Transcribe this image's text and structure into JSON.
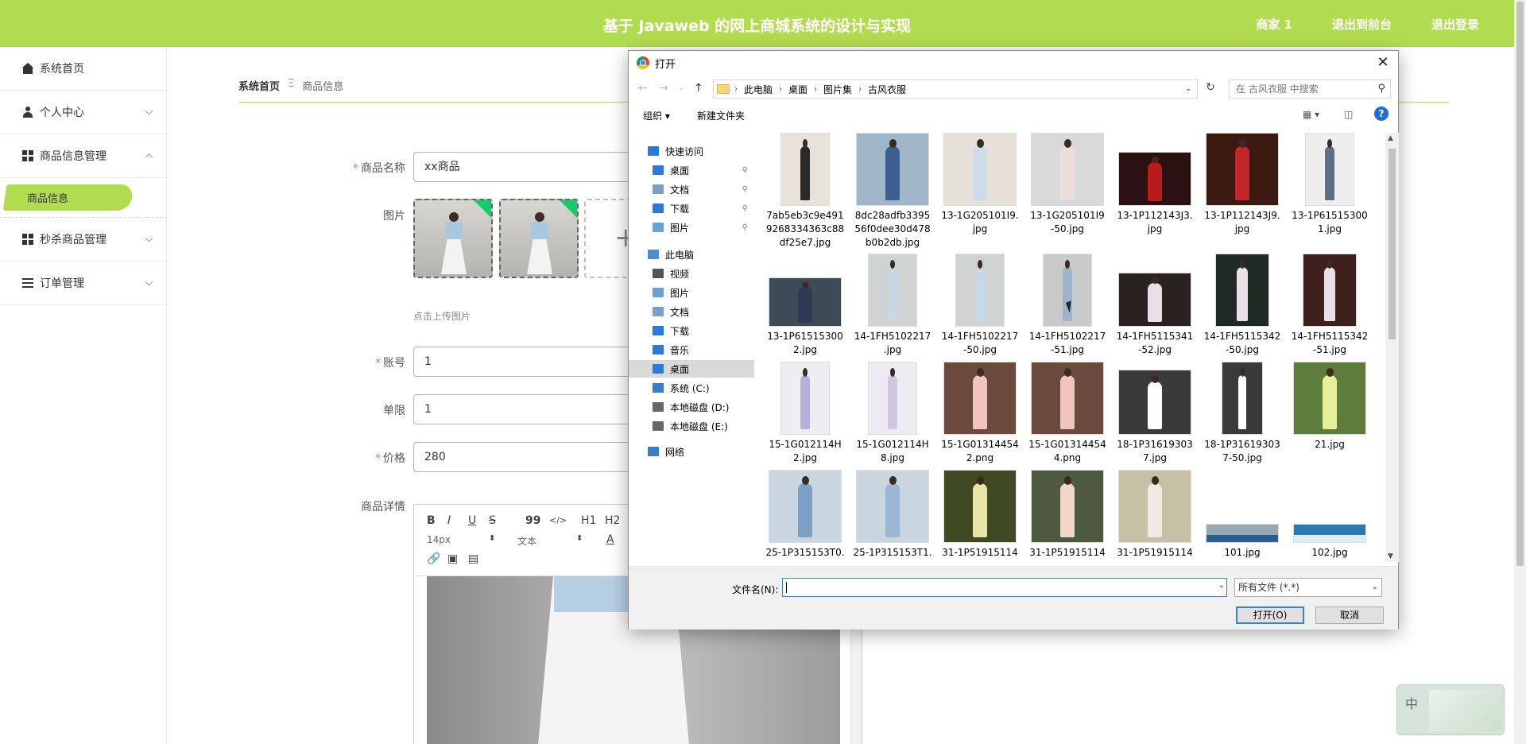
{
  "header": {
    "title": "基于 Javaweb 的网上商城系统的设计与实现",
    "links": [
      "商家 1",
      "退出到前台",
      "退出登录"
    ],
    "bg_color": "#b2dc4f"
  },
  "sidebar": {
    "items": [
      {
        "label": "系统首页",
        "icon": "home-icon"
      },
      {
        "label": "个人中心",
        "icon": "user-icon"
      },
      {
        "label": "商品信息管理",
        "icon": "grid-icon"
      },
      {
        "label": "商品信息",
        "icon": ""
      },
      {
        "label": "秒杀商品管理",
        "icon": "grid-icon"
      },
      {
        "label": "订单管理",
        "icon": "list-icon"
      }
    ]
  },
  "breadcrumb": {
    "home": "系统首页",
    "sep": "Ξ",
    "current": "商品信息"
  },
  "form": {
    "name_label": "商品名称",
    "name_value": "xx商品",
    "image_label": "图片",
    "upload_hint": "点击上传图片",
    "account_label": "账号",
    "account_value": "1",
    "limit_label": "单限",
    "limit_value": "1",
    "price_label": "价格",
    "price_value": "280",
    "detail_label": "商品详情"
  },
  "editor": {
    "toolbar_row1": [
      "B",
      "I",
      "U",
      "S",
      "99",
      "</>",
      "H1",
      "H2"
    ],
    "font_size": "14px",
    "block_type": "文本",
    "row3_icons": [
      "link-icon",
      "image-icon",
      "video-icon"
    ]
  },
  "dialog": {
    "title": "打开",
    "path": [
      "此电脑",
      "桌面",
      "图片集",
      "古风衣服"
    ],
    "search_placeholder": "在 古风衣服 中搜索",
    "organize": "组织 ▾",
    "new_folder": "新建文件夹",
    "nav": [
      {
        "label": "快速访问",
        "pin": false
      },
      {
        "label": "桌面",
        "pin": true
      },
      {
        "label": "文档",
        "pin": true
      },
      {
        "label": "下载",
        "pin": true
      },
      {
        "label": "图片",
        "pin": true
      },
      {
        "label": "此电脑",
        "pin": false
      },
      {
        "label": "视频",
        "pin": false
      },
      {
        "label": "图片",
        "pin": false
      },
      {
        "label": "文档",
        "pin": false
      },
      {
        "label": "下载",
        "pin": false
      },
      {
        "label": "音乐",
        "pin": false
      },
      {
        "label": "桌面",
        "pin": false
      },
      {
        "label": "系统 (C:)",
        "pin": false
      },
      {
        "label": "本地磁盘 (D:)",
        "pin": false
      },
      {
        "label": "本地磁盘 (E:)",
        "pin": false
      },
      {
        "label": "网络",
        "pin": false
      }
    ],
    "files": [
      [
        "7ab5eb3c9e491",
        "9268334363c88",
        "df25e7.jpg"
      ],
      [
        "8dc28adfb3395",
        "56f0dee30d478",
        "b0b2db.jpg"
      ],
      [
        "13-1G205101I9.",
        "jpg"
      ],
      [
        "13-1G205101I9",
        "-50.jpg"
      ],
      [
        "13-1P112143J3.",
        "jpg"
      ],
      [
        "13-1P112143J9.",
        "jpg"
      ],
      [
        "13-1P61515300",
        "1.jpg"
      ],
      [
        "13-1P61515300",
        "2.jpg"
      ],
      [
        "14-1FH5102217",
        ".jpg"
      ],
      [
        "14-1FH5102217",
        "-50.jpg"
      ],
      [
        "14-1FH5102217",
        "-51.jpg"
      ],
      [
        "14-1FH5115341",
        "-52.jpg"
      ],
      [
        "14-1FH5115342",
        "-50.jpg"
      ],
      [
        "14-1FH5115342",
        "-51.jpg"
      ],
      [
        "15-1G012114H",
        "2.jpg"
      ],
      [
        "15-1G012114H",
        "8.jpg"
      ],
      [
        "15-1G01314454",
        "2.png"
      ],
      [
        "15-1G01314454",
        "4.png"
      ],
      [
        "18-1P31619303",
        "7.jpg"
      ],
      [
        "18-1P31619303",
        "7-50.jpg"
      ],
      [
        "21.jpg"
      ],
      [
        "25-1P315153T0."
      ],
      [
        "25-1P315153T1."
      ],
      [
        "31-1P51915114"
      ],
      [
        "31-1P51915114"
      ],
      [
        "31-1P51915114"
      ],
      [
        "101.jpg"
      ],
      [
        "102.jpg"
      ]
    ],
    "file_name_label": "文件名(N):",
    "file_name_value": "",
    "file_type": "所有文件 (*.*)",
    "open_button": "打开(O)",
    "cancel_button": "取消"
  },
  "ime": {
    "label": "中"
  }
}
